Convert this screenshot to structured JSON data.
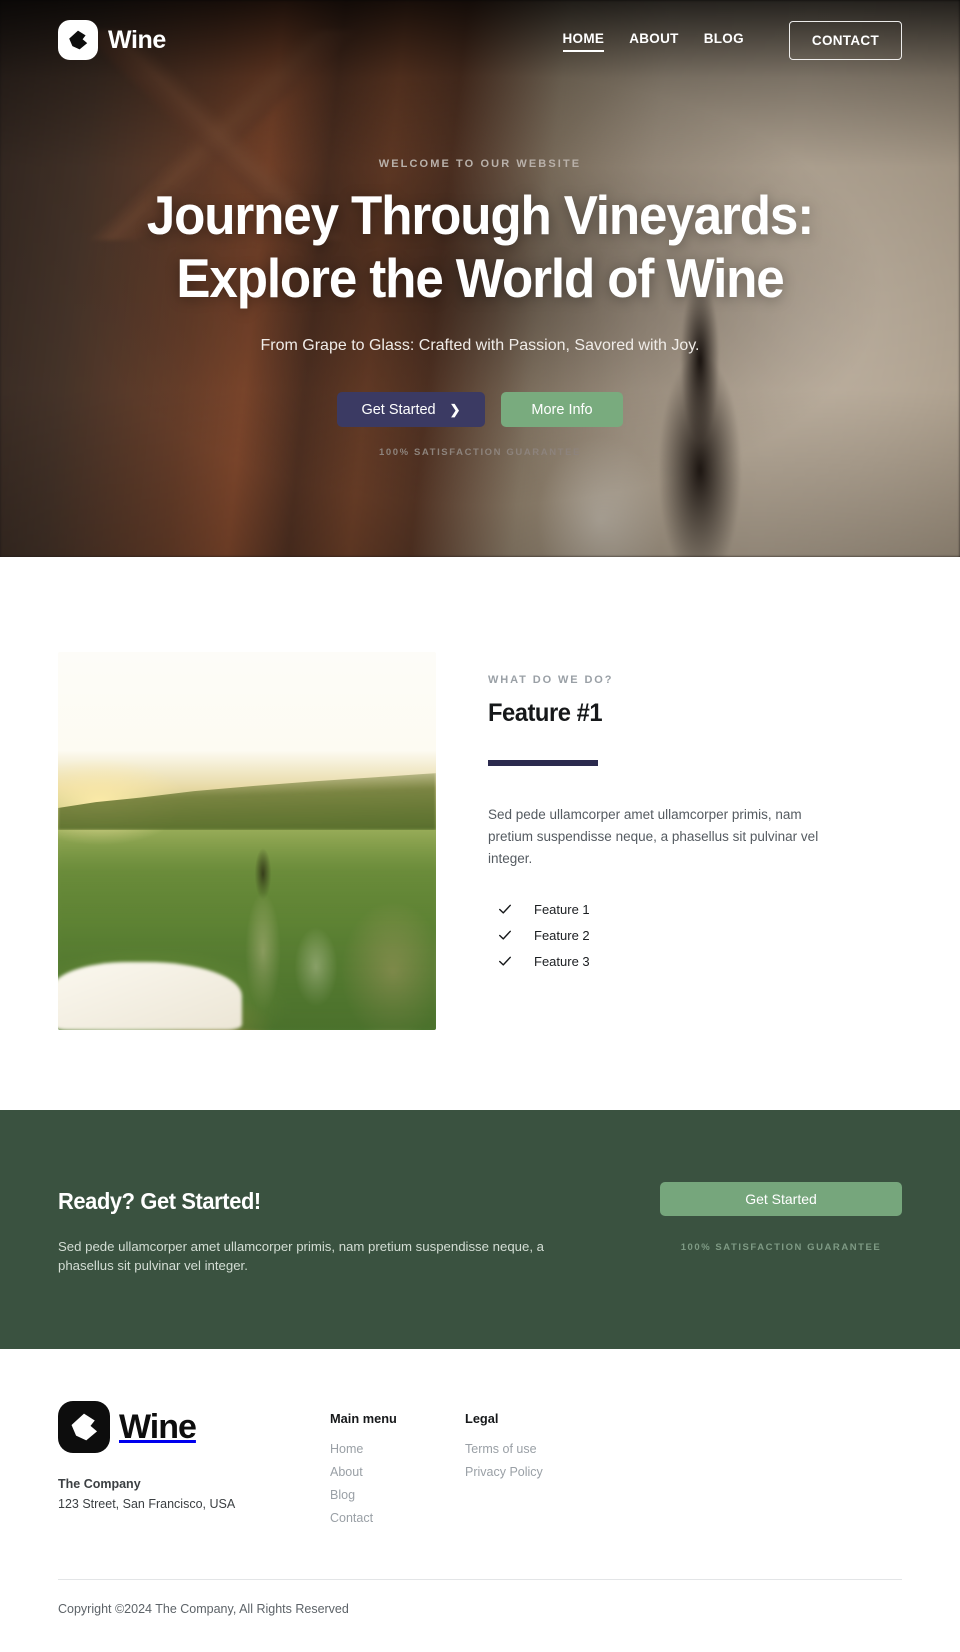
{
  "brand": {
    "name": "Wine",
    "logo_icon": "wine-polygon-logo-icon"
  },
  "nav": {
    "links": [
      {
        "label": "HOME",
        "active": true
      },
      {
        "label": "ABOUT",
        "active": false
      },
      {
        "label": "BLOG",
        "active": false
      }
    ],
    "cta_label": "CONTACT"
  },
  "hero": {
    "eyebrow": "WELCOME TO OUR WEBSITE",
    "title_line1": "Journey Through Vineyards:",
    "title_line2": "Explore the World of Wine",
    "subtitle": "From Grape to Glass: Crafted with Passion, Savored with Joy.",
    "primary_button": "Get Started",
    "primary_button_icon": "chevron-right-icon",
    "secondary_button": "More Info",
    "guarantee": "100% SATISFACTION GUARANTEE"
  },
  "feature": {
    "image_alt": "wine bottle and glasses on picnic blanket in vineyard at sunset",
    "kicker": "WHAT DO WE DO?",
    "title": "Feature #1",
    "text": "Sed pede ullamcorper amet ullamcorper primis, nam pretium suspendisse neque, a phasellus sit pulvinar vel integer.",
    "items": [
      {
        "label": "Feature 1",
        "icon": "check-icon"
      },
      {
        "label": "Feature 2",
        "icon": "check-icon"
      },
      {
        "label": "Feature 3",
        "icon": "check-icon"
      }
    ]
  },
  "cta": {
    "title": "Ready? Get Started!",
    "text": "Sed pede ullamcorper amet ullamcorper primis, nam pretium suspendisse neque, a phasellus sit pulvinar vel integer.",
    "button": "Get Started",
    "guarantee": "100% SATISFACTION GUARANTEE"
  },
  "footer": {
    "company_label": "The Company",
    "address": "123 Street, San Francisco, USA",
    "columns": [
      {
        "title": "Main menu",
        "links": [
          "Home",
          "About",
          "Blog",
          "Contact"
        ]
      },
      {
        "title": "Legal",
        "links": [
          "Terms of use",
          "Privacy Policy"
        ]
      }
    ],
    "copyright": "Copyright ©2024 The Company, All Rights Reserved"
  },
  "colors": {
    "cta_background": "#3a5240",
    "green_button": "#76a67c",
    "navy_button": "#3b3a63",
    "accent_bar": "#2b2a4e"
  }
}
